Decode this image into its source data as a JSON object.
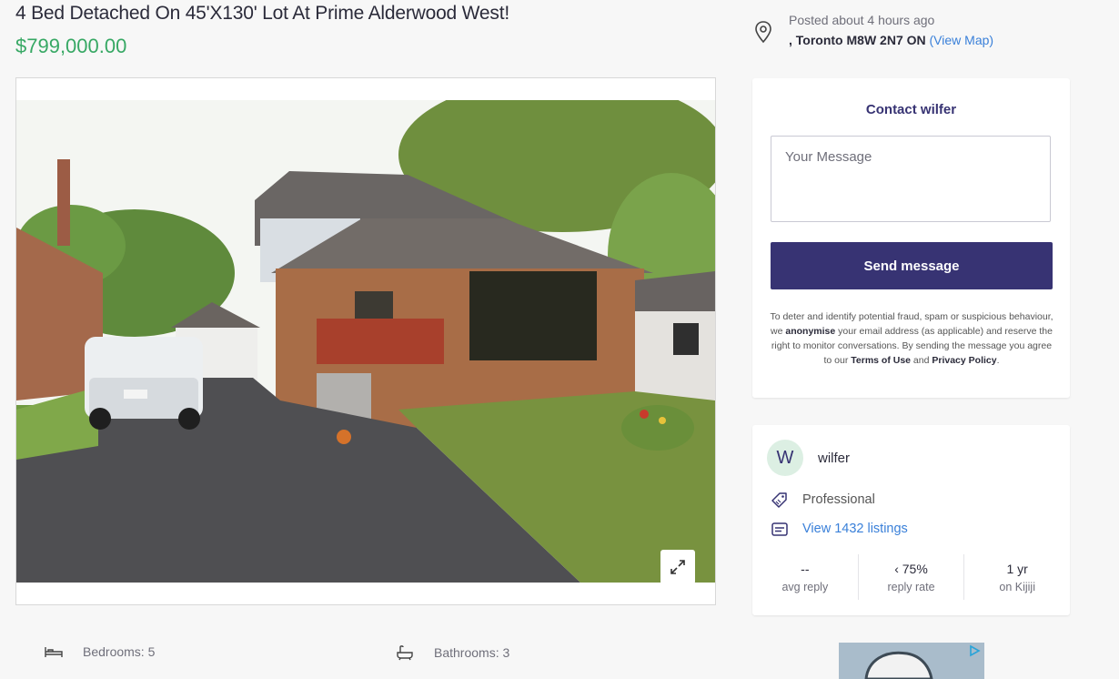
{
  "listing": {
    "title": "4 Bed Detached On 45'X130' Lot At Prime Alderwood West!",
    "price": "$799,000.00"
  },
  "posted": {
    "time": "Posted about 4 hours ago",
    "location": ", Toronto M8W 2N7 ON",
    "view_map": "(View Map)",
    "icon": "map-pin-icon"
  },
  "gallery": {
    "expand_icon": "expand-icon"
  },
  "contact": {
    "title": "Contact wilfer",
    "placeholder": "Your Message",
    "send_label": "Send message",
    "disclaimer": {
      "p1": "To deter and identify potential fraud, spam or suspicious behaviour, we ",
      "b1": "anonymise",
      "p2": " your email address (as applicable) and reserve the right to monitor conversations. By sending the message you agree to our ",
      "b2": "Terms of Use",
      "p3": " and ",
      "b3": "Privacy Policy",
      "p4": "."
    }
  },
  "seller": {
    "initial": "W",
    "name": "wilfer",
    "type": "Professional",
    "listings_link": "View 1432 listings",
    "stats": [
      {
        "value": "--",
        "label": "avg reply"
      },
      {
        "value": "‹ 75%",
        "label": "reply rate"
      },
      {
        "value": "1 yr",
        "label": "on Kijiji"
      }
    ]
  },
  "attributes": {
    "bedrooms": "Bedrooms: 5",
    "bathrooms": "Bathrooms: 3"
  },
  "colors": {
    "brand": "#373373",
    "price": "#37a864",
    "link": "#3a80d9"
  }
}
